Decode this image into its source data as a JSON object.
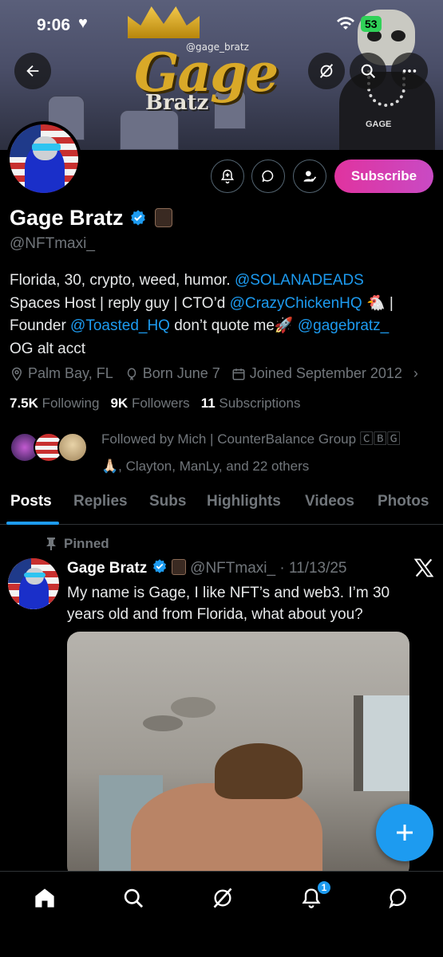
{
  "status_bar": {
    "time": "9:06",
    "battery": "53"
  },
  "banner": {
    "logo_text": "Gage",
    "logo_sub": "Bratz",
    "handle_tag": "@gage_bratz"
  },
  "profile": {
    "name": "Gage Bratz",
    "handle": "@NFTmaxi_",
    "subscribe_label": "Subscribe",
    "bio": {
      "t1": "Florida, 30, crypto, weed, humor. ",
      "l1": "@SOLANADEADS",
      "t2": "Spaces Host | reply guy | CTO’d ",
      "l2": "@CrazyChickenHQ",
      "t3": " 🐔 | Founder ",
      "l3": "@Toasted_HQ",
      "t4": " don’t quote me🚀 ",
      "l4": "@gagebratz_",
      "t5": "OG alt acct"
    },
    "location": "Palm Bay, FL",
    "born": "Born June 7",
    "joined": "Joined September 2012",
    "following_count": "7.5K",
    "following_label": "Following",
    "followers_count": "9K",
    "followers_label": "Followers",
    "subscriptions_count": "11",
    "subscriptions_label": "Subscriptions",
    "followed_by_line1": "Followed by Mich | CounterBalance Group 🄲🄱🄶",
    "followed_by_line2": "🙏🏻, Clayton, ManLy, and 22 others"
  },
  "tabs": [
    "Posts",
    "Replies",
    "Subs",
    "Highlights",
    "Videos",
    "Photos"
  ],
  "post": {
    "pinned_label": "Pinned",
    "author": "Gage Bratz",
    "handle_date": "@NFTmaxi_ · 11/13/25",
    "text": "My name is Gage, I like NFT’s and web3. I’m 30 years old and from Florida, what about you?"
  },
  "bottom_nav": {
    "notification_count": "1"
  },
  "colors": {
    "accent": "#1d9bf0",
    "subscribe_start": "#e0339f",
    "subscribe_end": "#c94ac4",
    "muted": "#71767b"
  },
  "icons": [
    "back-arrow-icon",
    "grok-icon",
    "search-icon",
    "more-icon",
    "add-notification-icon",
    "message-icon",
    "follow-user-icon",
    "verified-icon",
    "location-icon",
    "birthday-icon",
    "calendar-icon",
    "pin-icon",
    "x-logo-icon",
    "plus-icon",
    "home-icon",
    "bell-icon",
    "chat-icon"
  ]
}
